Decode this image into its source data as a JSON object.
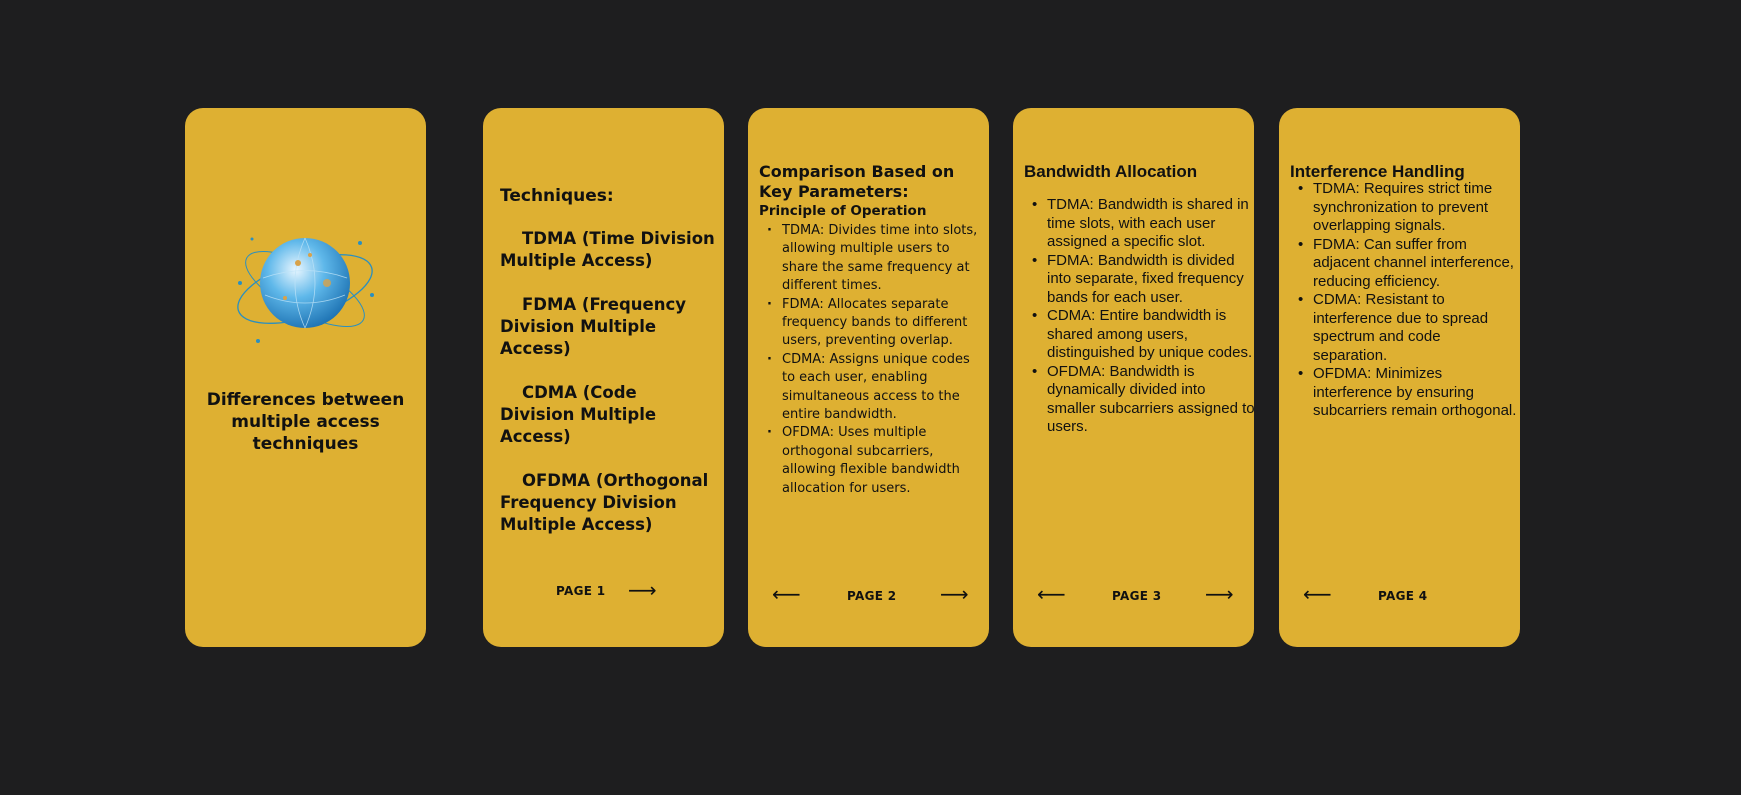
{
  "cover": {
    "title": "Differences between multiple access techniques",
    "image_icon": "globe-with-orbits-icon"
  },
  "page1": {
    "heading": "Techniques:",
    "items": [
      "TDMA (Time Division Multiple Access)",
      "FDMA (Frequency Division Multiple Access)",
      "CDMA (Code Division Multiple Access)",
      "OFDMA (Orthogonal Frequency Division Multiple Access)"
    ],
    "page_label": "PAGE 1",
    "next_arrow": "⟶"
  },
  "page2": {
    "heading": "Comparison Based on Key Parameters:",
    "subheading": "Principle of Operation",
    "items": [
      "TDMA: Divides time into slots, allowing multiple users to share the same frequency at different times.",
      "FDMA: Allocates separate frequency bands to different users, preventing overlap.",
      "CDMA: Assigns unique codes to each user, enabling simultaneous access to the entire bandwidth.",
      "OFDMA: Uses multiple orthogonal subcarriers, allowing flexible bandwidth allocation for users."
    ],
    "page_label": "PAGE 2",
    "prev_arrow": "⟵",
    "next_arrow": "⟶"
  },
  "page3": {
    "heading": "Bandwidth Allocation",
    "items": [
      "TDMA: Bandwidth is shared in time slots, with each user assigned a specific slot.",
      "FDMA: Bandwidth is divided into separate, fixed frequency bands for each user.",
      "CDMA: Entire bandwidth is shared among users, distinguished by unique codes.",
      "OFDMA: Bandwidth is dynamically divided into smaller subcarriers assigned to users."
    ],
    "page_label": "PAGE 3",
    "prev_arrow": "⟵",
    "next_arrow": "⟶"
  },
  "page4": {
    "heading": "Interference Handling",
    "items": [
      "TDMA: Requires strict time synchronization to prevent overlapping signals.",
      "FDMA: Can suffer from adjacent channel interference, reducing efficiency.",
      "CDMA: Resistant to interference due to spread spectrum and code separation.",
      "OFDMA: Minimizes interference by ensuring subcarriers remain orthogonal."
    ],
    "page_label": "PAGE 4",
    "prev_arrow": "⟵"
  },
  "colors": {
    "background": "#1e1e1f",
    "card": "#deb032",
    "text": "#111111"
  }
}
